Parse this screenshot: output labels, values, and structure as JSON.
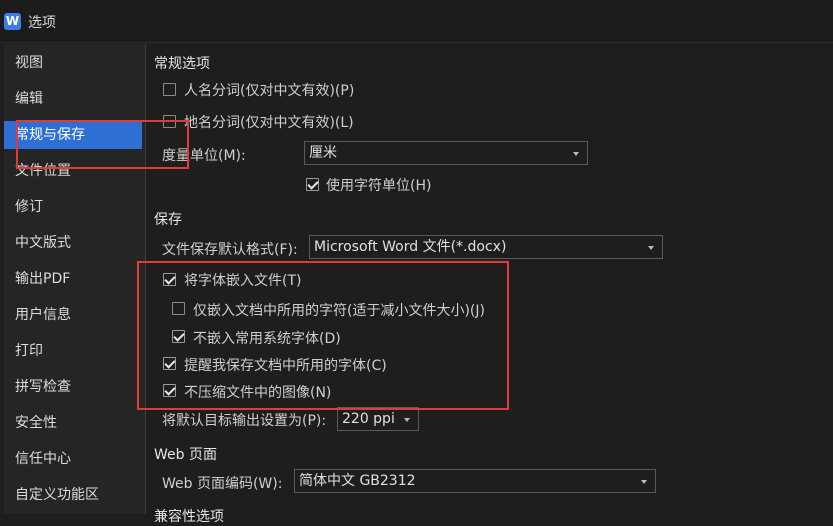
{
  "window": {
    "title": "选项",
    "logo_letter": "W"
  },
  "sidebar": {
    "items": [
      {
        "label": "视图"
      },
      {
        "label": "编辑"
      },
      {
        "label": "常规与保存"
      },
      {
        "label": "文件位置"
      },
      {
        "label": "修订"
      },
      {
        "label": "中文版式"
      },
      {
        "label": "输出PDF"
      },
      {
        "label": "用户信息"
      },
      {
        "label": "打印"
      },
      {
        "label": "拼写检查"
      },
      {
        "label": "安全性"
      },
      {
        "label": "信任中心"
      },
      {
        "label": "自定义功能区"
      }
    ],
    "active_item": "常规与保存"
  },
  "general": {
    "title": "常规选项",
    "person_name_seg": {
      "label": "人名分词(仅对中文有效)(P)",
      "checked": false
    },
    "place_name_seg": {
      "label": "地名分词(仅对中文有效)(L)",
      "checked": false
    },
    "unit_label": "度量单位(M):",
    "unit_value": "厘米",
    "char_unit": {
      "label": "使用字符单位(H)",
      "checked": true
    }
  },
  "save": {
    "title": "保存",
    "default_format_label": "文件保存默认格式(F):",
    "default_format_value": "Microsoft Word 文件(*.docx)",
    "embed_fonts": {
      "label": "将字体嵌入文件(T)",
      "checked": true
    },
    "embed_used_only": {
      "label": "仅嵌入文档中所用的字符(适于减小文件大小)(J)",
      "checked": false
    },
    "no_system_fonts": {
      "label": "不嵌入常用系统字体(D)",
      "checked": true
    },
    "remind_fonts": {
      "label": "提醒我保存文档中所用的字体(C)",
      "checked": true
    },
    "no_compress_images": {
      "label": "不压缩文件中的图像(N)",
      "checked": true
    },
    "target_output_label": "将默认目标输出设置为(P):",
    "target_output_value": "220 ppi"
  },
  "web": {
    "title": "Web 页面",
    "encoding_label": "Web 页面编码(W):",
    "encoding_value": "简体中文 GB2312"
  },
  "compat": {
    "title": "兼容性选项"
  },
  "colors": {
    "accent": "#2f6fd3",
    "highlight": "#e03a3a"
  }
}
